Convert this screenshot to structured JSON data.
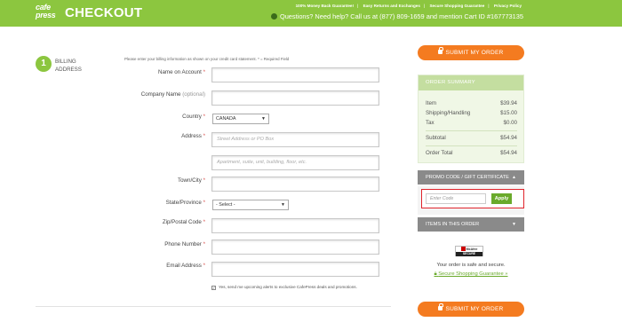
{
  "header": {
    "logo_top": "cafe",
    "logo_bottom": "press",
    "title": "CHECKOUT",
    "links": [
      "100% Money Back Guarantee!",
      "Easy Returns and Exchanges",
      "Secure Shopping Guarantee",
      "Privacy Policy"
    ],
    "help_text": "Questions? Need help? Call us at (877) 809-1659 and mention Cart ID #167773135"
  },
  "step": {
    "number": "1",
    "line1": "BILLING",
    "line2": "ADDRESS"
  },
  "form": {
    "intro": "Please enter your billing information as shown on your credit card statement. * = Required Field",
    "name_label": "Name on Account",
    "company_label": "Company Name",
    "company_optional": "(optional)",
    "country_label": "Country",
    "country_value": "CANADA",
    "address_label": "Address",
    "address1_placeholder": "Street Address or PO Box",
    "address2_placeholder": "Apartment, suite, unit, building, floor, etc.",
    "city_label": "Town/City",
    "state_label": "State/Province",
    "state_value": "- Select -",
    "zip_label": "Zip/Postal Code",
    "phone_label": "Phone Number",
    "email_label": "Email Address",
    "required_mark": "*",
    "opt_in_label": "Yes, send me upcoming alerts to exclusive CafePress deals and promotions.",
    "opt_in_checked": true
  },
  "summary": {
    "submit_label": "SUBMIT MY ORDER",
    "title": "ORDER SUMMARY",
    "rows": [
      {
        "label": "Item",
        "value": "$39.94"
      },
      {
        "label": "Shipping/Handling",
        "value": "$15.00"
      },
      {
        "label": "Tax",
        "value": "$0.00"
      },
      {
        "label": "Subtotal",
        "value": "$54.94"
      },
      {
        "label": "Order Total",
        "value": "$54.94"
      }
    ],
    "promo_title": "PROMO CODE / GIFT CERTIFICATE",
    "promo_placeholder": "Enter Code",
    "apply_label": "Apply",
    "items_title": "ITEMS IN THIS ORDER",
    "mcafee_brand": "McAfee",
    "mcafee_secure": "SECURE",
    "safe_text": "Your order is safe and secure.",
    "guarantee_link": "Secure Shopping Guarantee »"
  },
  "colors": {
    "brand_green": "#8cc63f",
    "submit_orange": "#f47b20",
    "apply_green": "#6aaa2b",
    "highlight_red": "#e0232b"
  }
}
